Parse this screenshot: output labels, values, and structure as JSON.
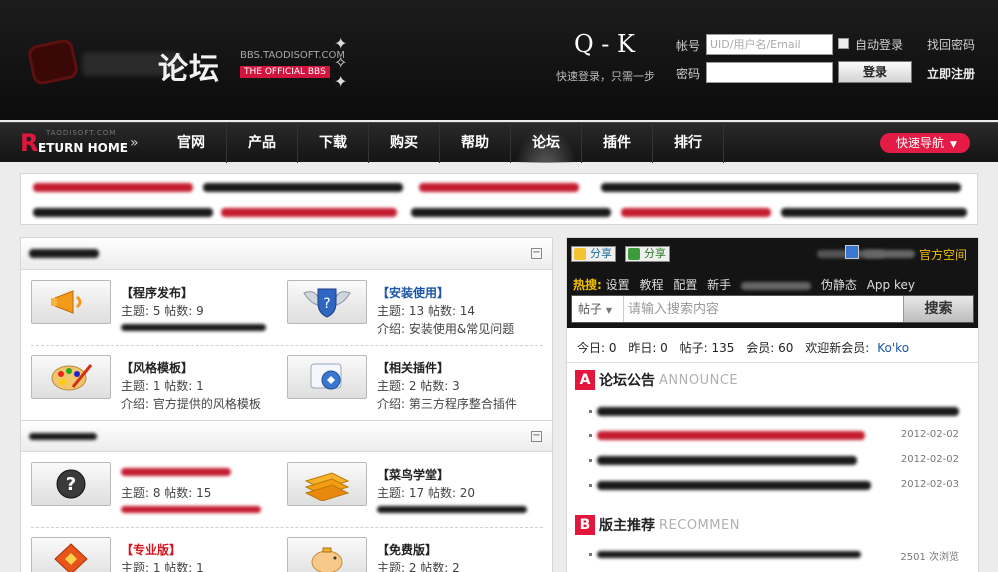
{
  "header": {
    "logo_name": "论坛",
    "logo_domain": "BBS.TAODISOFT.COM",
    "logo_tagline": "THE OFFICIAL BBS",
    "qq_glyph": "Q - K",
    "qq_login_text": "快速登录，只需一步"
  },
  "login": {
    "account_label": "帐号",
    "account_placeholder": "UID/用户名/Email",
    "password_label": "密码",
    "auto_login_label": "自动登录",
    "forgot_label": "找回密码",
    "login_button": "登录",
    "register_label": "立即注册"
  },
  "nav": {
    "return_small": "TAODISOFT.COM",
    "return_main": "ETURN HOME",
    "return_letter": "R",
    "return_arrow": "»",
    "items": [
      {
        "label": "官网"
      },
      {
        "label": "产品"
      },
      {
        "label": "下载"
      },
      {
        "label": "购买"
      },
      {
        "label": "帮助"
      },
      {
        "label": "论坛"
      },
      {
        "label": "插件"
      },
      {
        "label": "排行"
      }
    ],
    "active_index": 5,
    "quick_nav": "快速导航"
  },
  "left": {
    "forums": [
      {
        "title": "【程序发布】",
        "stats": "主题: 5 帖数: 9",
        "desc": ""
      },
      {
        "title": "【安装使用】",
        "stats": "主题: 13 帖数: 14",
        "desc": "介绍: 安装使用&常见问题"
      },
      {
        "title": "【风格模板】",
        "stats": "主题: 1 帖数: 1",
        "desc": "介绍: 官方提供的风格模板"
      },
      {
        "title": "【相关插件】",
        "stats": "主题: 2 帖数: 3",
        "desc": "介绍: 第三方程序整合插件"
      },
      {
        "title": "",
        "stats": "主题: 8 帖数: 15",
        "desc": ""
      },
      {
        "title": "【菜鸟学堂】",
        "stats": "主题: 17 帖数: 20",
        "desc": ""
      },
      {
        "title": "【专业版】",
        "stats": "主题: 1 帖数: 1",
        "desc": ""
      },
      {
        "title": "【免费版】",
        "stats": "主题: 2 帖数: 2",
        "desc": ""
      }
    ],
    "collapse_glyph": "−"
  },
  "right": {
    "share1": "分享",
    "share2": "分享",
    "official_space": "官方空间",
    "hot_label": "热搜:",
    "hot_items": [
      "设置",
      "教程",
      "配置",
      "新手",
      "伪静态",
      "App key"
    ],
    "search_type": "帖子",
    "search_placeholder": "请输入搜索内容",
    "search_button": "搜索",
    "stats": {
      "today": "今日: 0",
      "yesterday": "昨日: 0",
      "posts": "帖子: 135",
      "members": "会员: 60",
      "welcome": "欢迎新会员:",
      "new_member": "Ko'ko"
    },
    "announce": {
      "letter": "A",
      "cn": "论坛公告",
      "en": "ANNOUNCE",
      "dates": [
        "",
        "2012-02-02",
        "2012-02-02",
        "2012-02-03"
      ]
    },
    "recommend": {
      "letter": "B",
      "cn": "版主推荐",
      "en": "RECOMMEN",
      "first_views": "2501 次浏览"
    }
  },
  "colors": {
    "accent": "#e3163e",
    "header_bg": "#141414",
    "link_blue": "#1b57a8",
    "gold": "#f0c000"
  }
}
